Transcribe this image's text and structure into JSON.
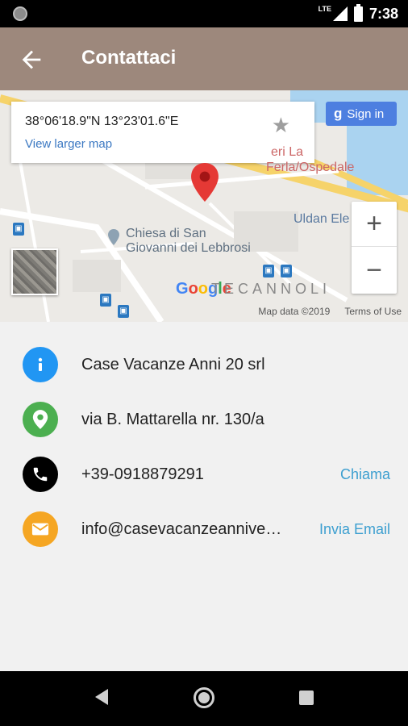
{
  "status_bar": {
    "network": "LTE",
    "time": "7:38"
  },
  "app_bar": {
    "title": "Contattaci",
    "back_icon": "arrow-back-icon"
  },
  "map": {
    "coordinates": "38°06'18.9\"N 13°23'01.6\"E",
    "larger_map_link": "View larger map",
    "sign_in_label": "Sign in",
    "sign_in_g": "g",
    "zoom_in": "+",
    "zoom_out": "−",
    "labels": {
      "ospedale_1": "eri La",
      "ospedale_2": "Ferla/Ospedale",
      "chiesa_1": "Chiesa di San",
      "chiesa_2": "Giovanni dei Lebbrosi",
      "uldan": "Uldan Ele",
      "tecannoli": "TECANNOLI"
    },
    "google_logo": "Google",
    "map_data": "Map data ©2019",
    "terms": "Terms of Use"
  },
  "contacts": [
    {
      "icon": "info-icon",
      "color": "#2196f3",
      "text": "Case Vacanze Anni 20 srl",
      "action": ""
    },
    {
      "icon": "location-icon",
      "color": "#4caf50",
      "text": "via B. Mattarella nr. 130/a",
      "action": ""
    },
    {
      "icon": "phone-icon",
      "color": "#000000",
      "text": "+39-0918879291",
      "action": "Chiama"
    },
    {
      "icon": "email-icon",
      "color": "#f5a623",
      "text": "info@casevacanzeannive…",
      "action": "Invia Email"
    }
  ]
}
